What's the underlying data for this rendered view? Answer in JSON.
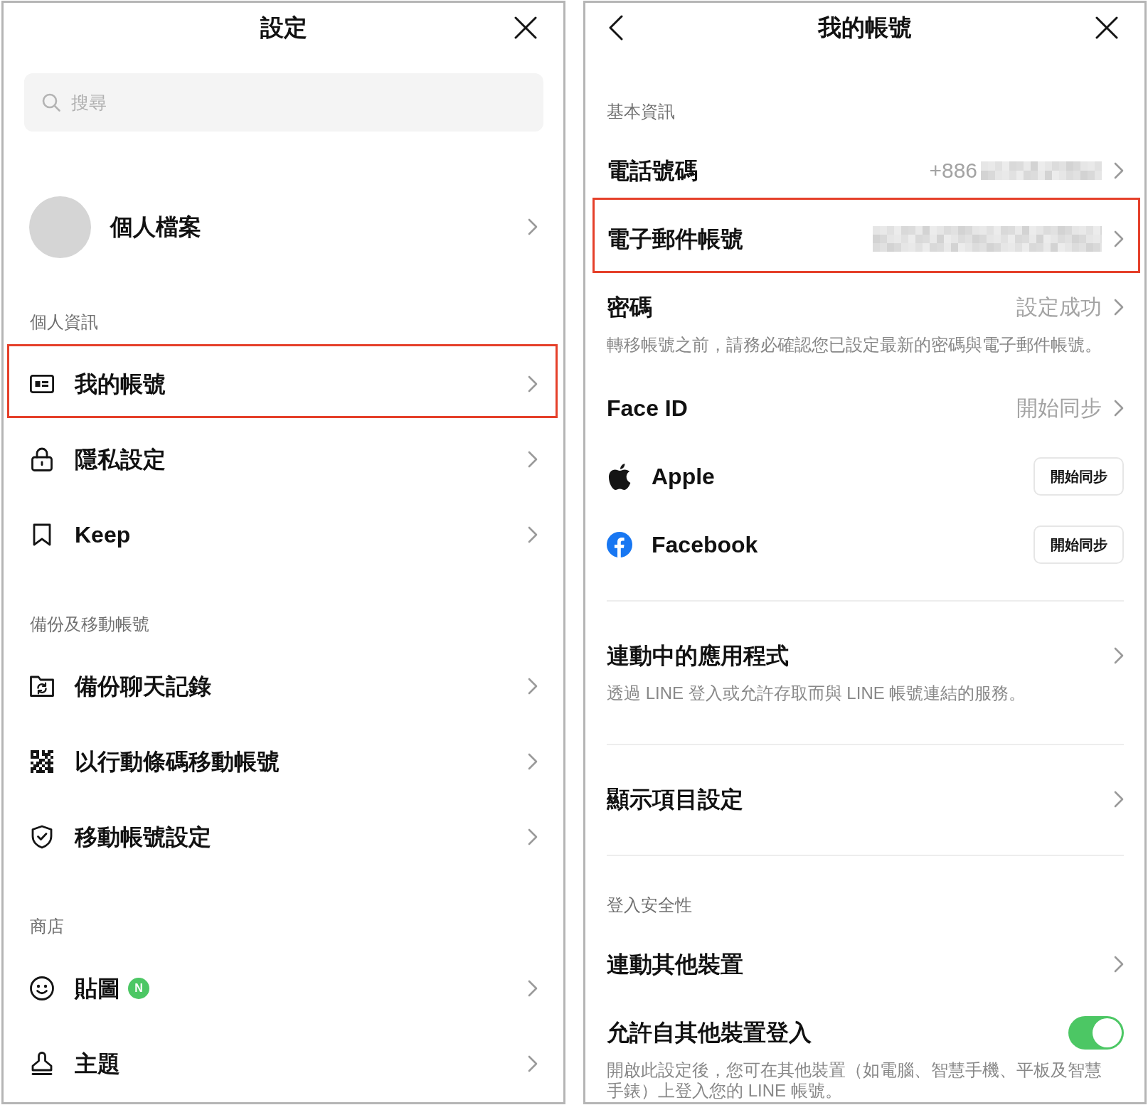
{
  "settings_panel": {
    "title": "設定",
    "search": {
      "placeholder": "搜尋"
    },
    "profile": {
      "label": "個人檔案"
    },
    "sections": [
      {
        "header": "個人資訊",
        "items": [
          {
            "label": "我的帳號",
            "highlighted": true
          },
          {
            "label": "隱私設定",
            "highlighted": false
          },
          {
            "label": "Keep",
            "highlighted": false
          }
        ]
      },
      {
        "header": "備份及移動帳號",
        "items": [
          {
            "label": "備份聊天記錄",
            "highlighted": false
          },
          {
            "label": "以行動條碼移動帳號",
            "highlighted": false
          },
          {
            "label": "移動帳號設定",
            "highlighted": false
          }
        ]
      },
      {
        "header": "商店",
        "items": [
          {
            "label": "貼圖",
            "badge": "N",
            "highlighted": false
          },
          {
            "label": "主題",
            "highlighted": false
          }
        ]
      }
    ]
  },
  "account_panel": {
    "title": "我的帳號",
    "sections": [
      {
        "header": "基本資訊",
        "items": [
          {
            "kind": "link",
            "label": "電話號碼",
            "value": "+886",
            "redacted": true,
            "highlighted": false
          },
          {
            "kind": "link",
            "label": "電子郵件帳號",
            "redacted": true,
            "highlighted": true
          },
          {
            "kind": "link",
            "label": "密碼",
            "value": "設定成功",
            "description": "轉移帳號之前，請務必確認您已設定最新的密碼與電子郵件帳號。",
            "redacted": false,
            "highlighted": false
          },
          {
            "kind": "link",
            "label": "Face ID",
            "value": "開始同步",
            "redacted": false,
            "highlighted": false
          },
          {
            "kind": "sync",
            "label": "Apple",
            "button": "開始同步",
            "highlighted": false
          },
          {
            "kind": "sync",
            "label": "Facebook",
            "button": "開始同步",
            "highlighted": false
          }
        ]
      },
      {
        "items": [
          {
            "kind": "link",
            "label": "連動中的應用程式",
            "description": "透過 LINE 登入或允許存取而與 LINE 帳號連結的服務。",
            "redacted": false,
            "highlighted": false
          }
        ]
      },
      {
        "items": [
          {
            "kind": "link",
            "label": "顯示項目設定",
            "redacted": false,
            "highlighted": false
          }
        ]
      },
      {
        "header": "登入安全性",
        "items": [
          {
            "kind": "link",
            "label": "連動其他裝置",
            "redacted": false,
            "highlighted": false
          },
          {
            "kind": "toggle",
            "label": "允許自其他裝置登入",
            "on": true,
            "description": "開啟此設定後，您可在其他裝置（如電腦、智慧手機、平板及智慧手錶）上登入您的 LINE 帳號。",
            "highlighted": false
          }
        ]
      }
    ]
  }
}
